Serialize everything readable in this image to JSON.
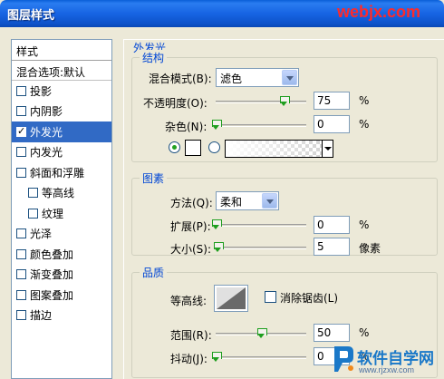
{
  "window": {
    "title": "图层样式",
    "watermark": "webjx.com"
  },
  "style_list": {
    "header": "样式",
    "blend_options": "混合选项:默认",
    "items": [
      {
        "label": "投影",
        "checked": false,
        "indent": false
      },
      {
        "label": "内阴影",
        "checked": false,
        "indent": false
      },
      {
        "label": "外发光",
        "checked": true,
        "indent": false,
        "selected": true
      },
      {
        "label": "内发光",
        "checked": false,
        "indent": false
      },
      {
        "label": "斜面和浮雕",
        "checked": false,
        "indent": false
      },
      {
        "label": "等高线",
        "checked": false,
        "indent": true
      },
      {
        "label": "纹理",
        "checked": false,
        "indent": true
      },
      {
        "label": "光泽",
        "checked": false,
        "indent": false
      },
      {
        "label": "颜色叠加",
        "checked": false,
        "indent": false
      },
      {
        "label": "渐变叠加",
        "checked": false,
        "indent": false
      },
      {
        "label": "图案叠加",
        "checked": false,
        "indent": false
      },
      {
        "label": "描边",
        "checked": false,
        "indent": false
      }
    ]
  },
  "outer_glow": {
    "section_title": "外发光",
    "structure": {
      "title": "结构",
      "blend_mode_label": "混合模式(B):",
      "blend_mode_value": "滤色",
      "opacity_label": "不透明度(O):",
      "opacity_value": "75",
      "opacity_unit": "%",
      "opacity_level": 0.75,
      "noise_label": "杂色(N):",
      "noise_value": "0",
      "noise_unit": "%",
      "noise_level": 0,
      "color_radio_selected": "solid",
      "glow_color": "#ffffff"
    },
    "elements": {
      "title": "图素",
      "technique_label": "方法(Q):",
      "technique_value": "柔和",
      "spread_label": "扩展(P):",
      "spread_value": "0",
      "spread_unit": "%",
      "spread_level": 0,
      "size_label": "大小(S):",
      "size_value": "5",
      "size_unit": "像素",
      "size_level": 0.02
    },
    "quality": {
      "title": "品质",
      "contour_label": "等高线:",
      "antialias_label": "消除锯齿(L)",
      "antialias_checked": false,
      "range_label": "范围(R):",
      "range_value": "50",
      "range_unit": "%",
      "range_level": 0.5,
      "jitter_label": "抖动(J):",
      "jitter_value": "0",
      "jitter_unit": "%",
      "jitter_level": 0
    }
  },
  "watermark_logo": {
    "text": "软件自学网",
    "url": "www.rjzxw.com"
  },
  "colors": {
    "title_bar": "#0a5fd8",
    "selection": "#316ac5",
    "section_title": "#0046d5",
    "slider_thumb": "#1e9e1e"
  }
}
